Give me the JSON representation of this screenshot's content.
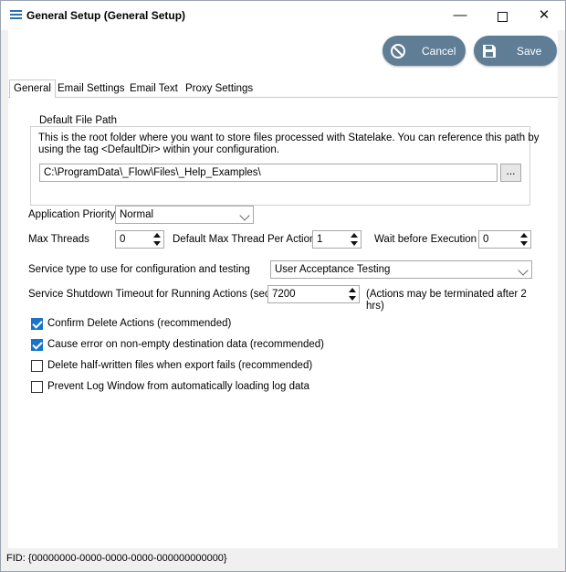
{
  "window": {
    "title": "General Setup (General Setup)",
    "minimize": "—",
    "maximize": "☐",
    "close": "✕"
  },
  "toolbar": {
    "cancel_label": "Cancel",
    "save_label": "Save",
    "accent": "#5f7d95"
  },
  "tabs": [
    "General",
    "Email Settings",
    "Email Text",
    "Proxy Settings"
  ],
  "general": {
    "default_path_group": "Default File Path",
    "default_path_desc_1": "This is the root folder where you want to store files processed with Statelake.  You can reference this path by",
    "default_path_desc_2": "using the tag <DefaultDir> within your configuration.",
    "default_path_value": "C:\\ProgramData\\_Flow\\Files\\_Help_Examples\\",
    "browse_label": "...",
    "app_priority_label": "Application Priority",
    "app_priority_value": "Normal",
    "max_threads_label": "Max Threads",
    "max_threads_value": "0",
    "default_max_thread_label": "Default Max Thread Per Action",
    "default_max_thread_value": "1",
    "wait_before_exec_label": "Wait before Execution",
    "wait_before_exec_value": "0",
    "service_type_label": "Service type to use for configuration and testing",
    "service_type_value": "User Acceptance Testing",
    "shutdown_timeout_label": "Service Shutdown Timeout for Running Actions (secs)",
    "shutdown_timeout_value": "7200",
    "shutdown_note_1": "(Actions may be terminated after 2",
    "shutdown_note_2": "hrs)",
    "checkboxes": [
      {
        "label": "Confirm Delete Actions (recommended)",
        "checked": true
      },
      {
        "label": "Cause error on non-empty destination data (recommended)",
        "checked": true
      },
      {
        "label": "Delete half-written files when export fails (recommended)",
        "checked": false
      },
      {
        "label": "Prevent Log Window from automatically loading log data",
        "checked": false
      }
    ]
  },
  "status": {
    "fid": "FID: {00000000-0000-0000-0000-000000000000}"
  }
}
